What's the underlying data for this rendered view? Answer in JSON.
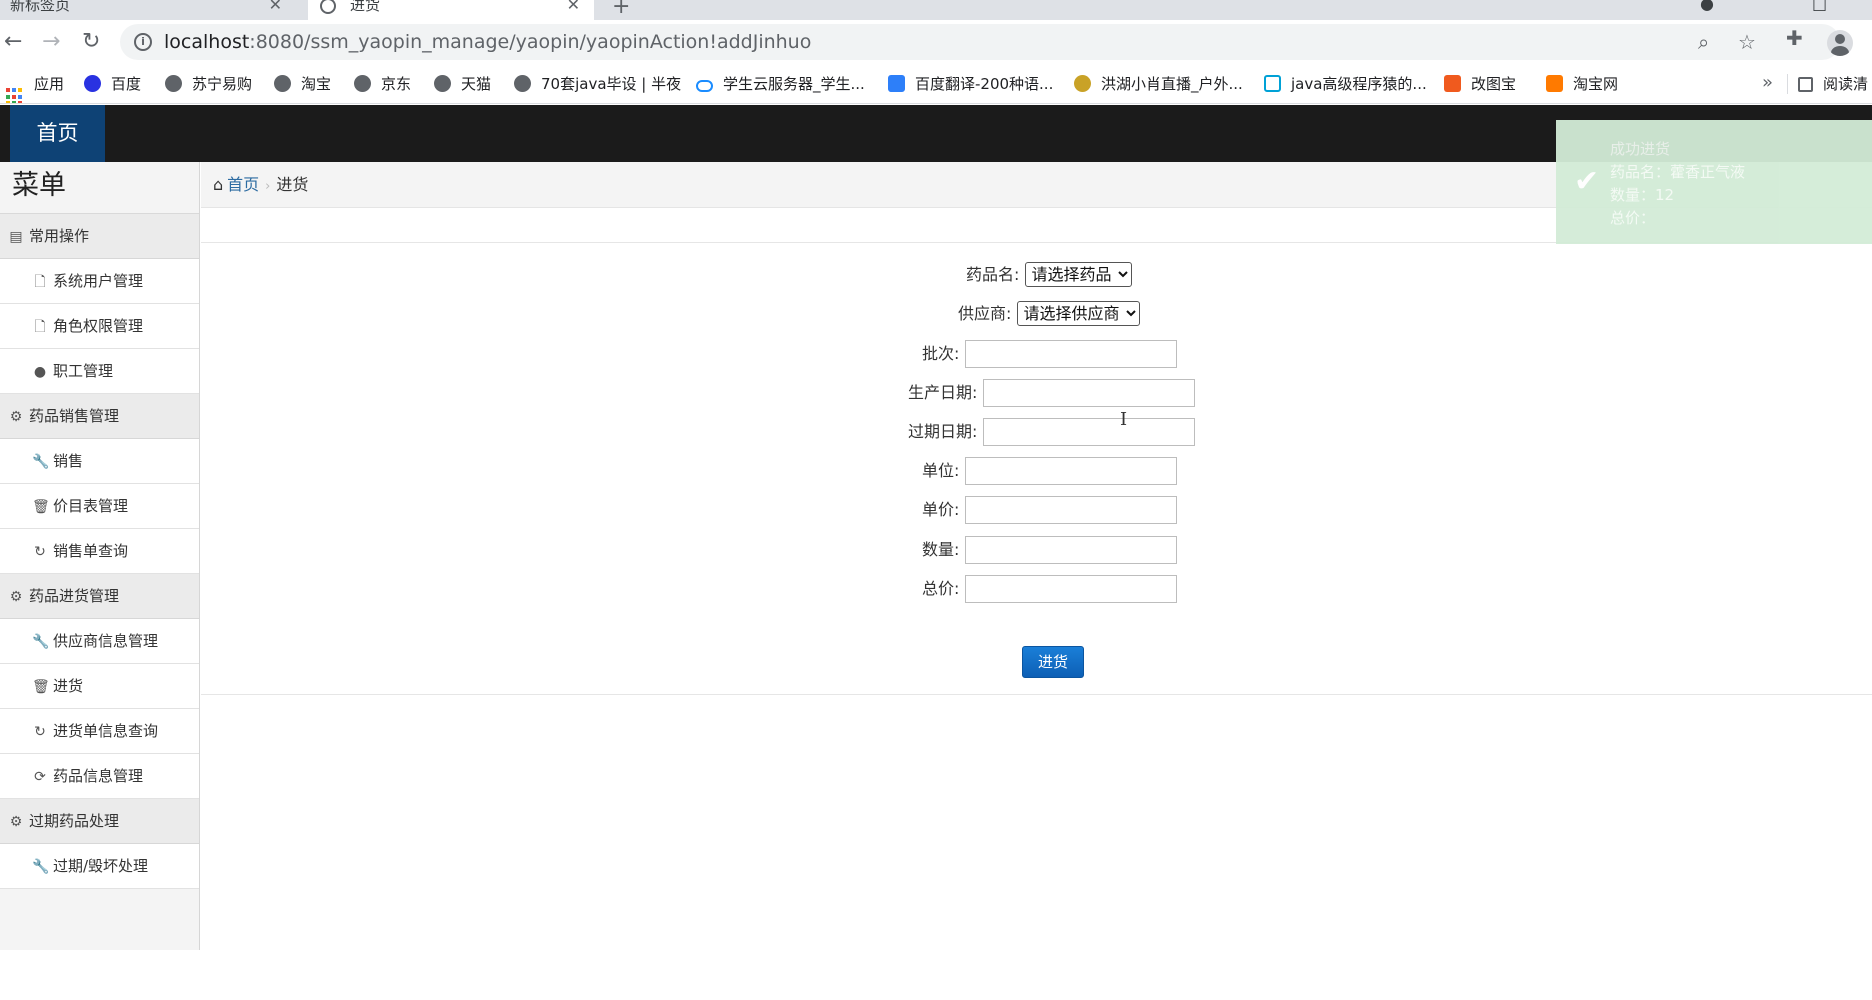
{
  "browser": {
    "tabs": [
      {
        "title": "新标签页",
        "active": false
      },
      {
        "title": "进货",
        "active": true
      }
    ],
    "url_host": "localhost",
    "url_path": ":8080/ssm_yaopin_manage/yaopin/yaopinAction!addJinhuo",
    "icons": {
      "back": "back-arrow-icon",
      "forward": "forward-arrow-icon",
      "reload": "reload-icon",
      "info": "info-icon",
      "zoom": "zoom-icon",
      "star": "star-icon",
      "extensions": "puzzle-icon",
      "profile": "profile-icon"
    },
    "bookmarks": [
      {
        "label": "应用",
        "icon": "apps-grid-icon"
      },
      {
        "label": "百度",
        "icon": "paw-icon"
      },
      {
        "label": "苏宁易购",
        "icon": "globe-icon"
      },
      {
        "label": "淘宝",
        "icon": "globe-icon"
      },
      {
        "label": "京东",
        "icon": "globe-icon"
      },
      {
        "label": "天猫",
        "icon": "globe-icon"
      },
      {
        "label": "70套java毕设 | 半夜",
        "icon": "globe-icon"
      },
      {
        "label": "学生云服务器_学生...",
        "icon": "cloud-icon"
      },
      {
        "label": "百度翻译-200种语...",
        "icon": "translate-icon"
      },
      {
        "label": "洪湖小肖直播_户外...",
        "icon": "bird-icon"
      },
      {
        "label": "java高级程序猿的...",
        "icon": "tv-icon"
      },
      {
        "label": "改图宝",
        "icon": "image-icon"
      },
      {
        "label": "淘宝网",
        "icon": "taobao-icon"
      }
    ],
    "bookmarks_overflow": "»",
    "reading_list": "阅读清"
  },
  "header": {
    "home_label": "首页"
  },
  "sidebar": {
    "title": "菜单",
    "groups": [
      {
        "label": "常用操作",
        "icon": "list-icon",
        "items": [
          {
            "label": "系统用户管理",
            "icon": "file-icon"
          },
          {
            "label": "角色权限管理",
            "icon": "file-icon"
          },
          {
            "label": "职工管理",
            "icon": "comment-icon"
          }
        ]
      },
      {
        "label": "药品销售管理",
        "icon": "gear-icon",
        "items": [
          {
            "label": "销售",
            "icon": "wrench-icon"
          },
          {
            "label": "价目表管理",
            "icon": "trash-icon"
          },
          {
            "label": "销售单查询",
            "icon": "refresh-icon"
          }
        ]
      },
      {
        "label": "药品进货管理",
        "icon": "gear-icon",
        "items": [
          {
            "label": "供应商信息管理",
            "icon": "wrench-icon"
          },
          {
            "label": "进货",
            "icon": "trash-icon"
          },
          {
            "label": "进货单信息查询",
            "icon": "refresh-icon"
          },
          {
            "label": "药品信息管理",
            "icon": "sync-icon"
          }
        ]
      },
      {
        "label": "过期药品处理",
        "icon": "gear-icon",
        "items": [
          {
            "label": "过期/毁坏处理",
            "icon": "wrench-icon"
          }
        ]
      }
    ]
  },
  "breadcrumb": {
    "home": "首页",
    "current": "进货"
  },
  "form": {
    "drug_label": "药品名:",
    "drug_value": "请选择药品",
    "supplier_label": "供应商:",
    "supplier_value": "请选择供应商",
    "batch_label": "批次:",
    "prod_date_label": "生产日期:",
    "exp_date_label": "过期日期:",
    "unit_label": "单位:",
    "price_label": "单价:",
    "qty_label": "数量:",
    "total_label": "总价:",
    "submit_label": "进货"
  },
  "toast": {
    "title": "成功进货",
    "drug_line": "药品名：藿香正气液",
    "qty_line": "数量：12",
    "total_line": "总价："
  },
  "colors": {
    "header_bg": "#1b1b1b",
    "home_tab_bg": "#0e4275",
    "link": "#2d6ca2",
    "submit_bg": "#1672c9",
    "toast_bg": "#d3ecd7"
  }
}
